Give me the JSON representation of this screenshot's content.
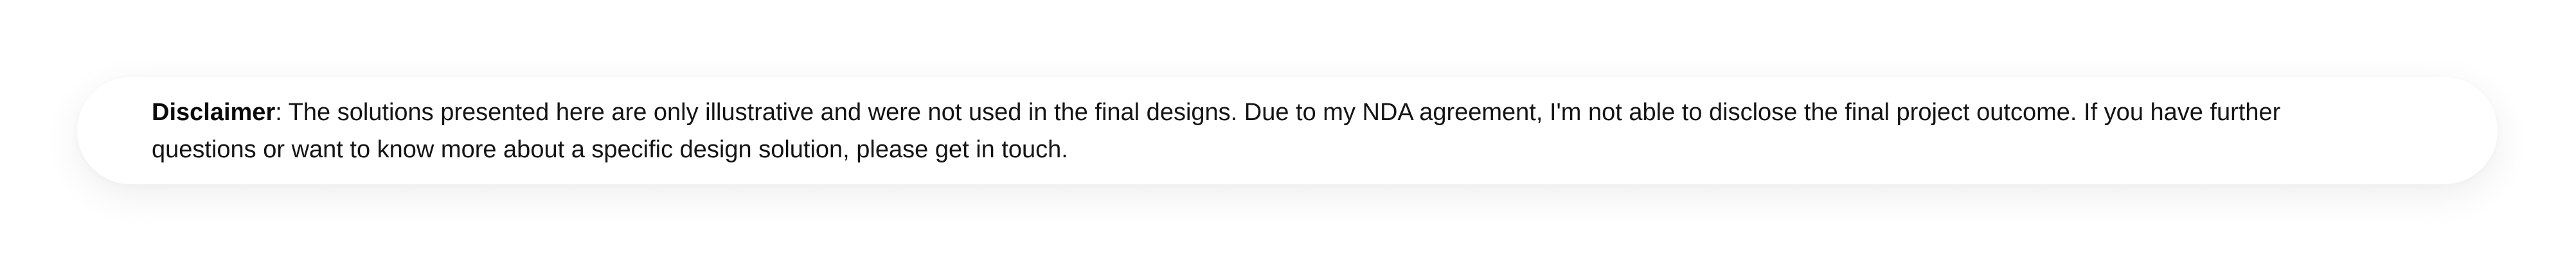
{
  "disclaimer": {
    "label": "Disclaimer",
    "separator": ": ",
    "body": "The solutions presented here are only illustrative and were not used in the final designs. Due to my NDA agreement, I'm not able to disclose the final project outcome. If you have further questions or want to know more about a specific design solution, please get in touch."
  }
}
